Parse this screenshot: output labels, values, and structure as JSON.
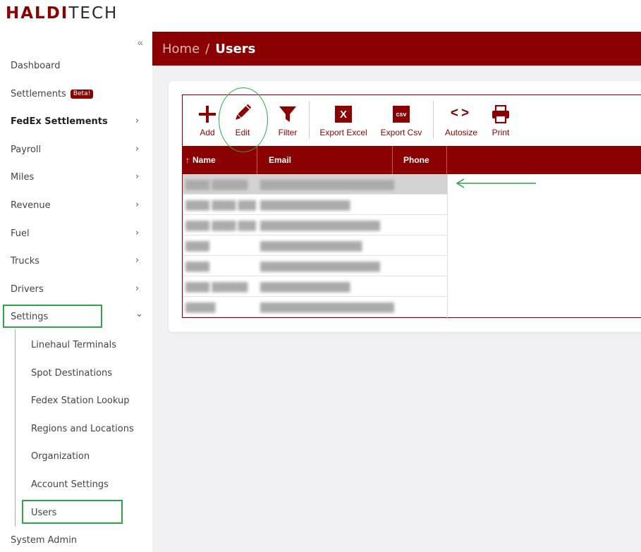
{
  "logo": {
    "brand": "HALDI",
    "rest": "TECH"
  },
  "sidebar": {
    "collapse_label": "«",
    "items": [
      {
        "label": "Dashboard",
        "chevron": ""
      },
      {
        "label": "Settlements",
        "badge": "Beta!",
        "chevron": ""
      },
      {
        "label": "FedEx Settlements",
        "chevron": "›"
      },
      {
        "label": "Payroll",
        "chevron": "›"
      },
      {
        "label": "Miles",
        "chevron": "›"
      },
      {
        "label": "Revenue",
        "chevron": "›"
      },
      {
        "label": "Fuel",
        "chevron": "›"
      },
      {
        "label": "Trucks",
        "chevron": "›"
      },
      {
        "label": "Drivers",
        "chevron": "›"
      },
      {
        "label": "Settings",
        "chevron": "⌄"
      }
    ],
    "settings_sub": [
      "Linehaul Terminals",
      "Spot Destinations",
      "Fedex Station Lookup",
      "Regions and Locations",
      "Organization",
      "Account Settings",
      "Users"
    ],
    "last_item": "System Admin"
  },
  "breadcrumb": {
    "home": "Home",
    "separator": "/",
    "current": "Users"
  },
  "toolbar": {
    "add": "Add",
    "edit": "Edit",
    "filter": "Filter",
    "export_excel": "Export Excel",
    "excel_icon_text": "X",
    "export_csv": "Export Csv",
    "csv_icon_text": "csv",
    "autosize": "Autosize",
    "autosize_icon_text": "<>",
    "print": "Print"
  },
  "table": {
    "sort_icon": "↑",
    "columns": [
      "Name",
      "Email",
      "Phone"
    ],
    "rows": [
      {
        "name": "████ ██████",
        "email": "███████████████████████"
      },
      {
        "name": "████ ████ ██████",
        "email": "███████████████"
      },
      {
        "name": "████ ████ █████",
        "email": "████████████████████"
      },
      {
        "name": "████",
        "email": "█████████████████"
      },
      {
        "name": "████",
        "email": "████████████████████"
      },
      {
        "name": "████ ██████",
        "email": "███████████████"
      },
      {
        "name": "█████",
        "email": "███████████████████████"
      }
    ]
  },
  "colors": {
    "accent": "#8b0000",
    "highlight_green": "#2ca44b",
    "background": "#f1f1f3"
  }
}
